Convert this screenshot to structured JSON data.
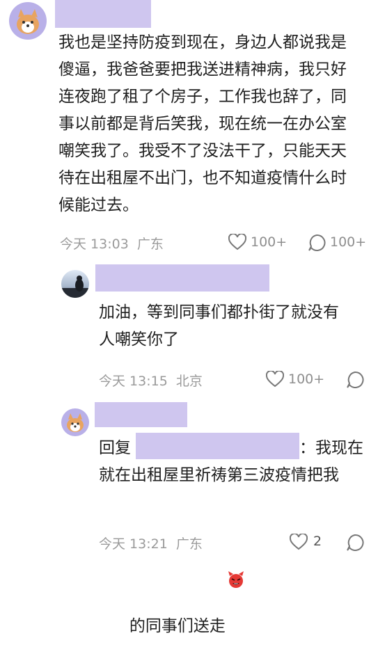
{
  "comments": [
    {
      "text_lines": [
        "我也是坚持防疫到现在，身边人都说我是",
        "傻逼，我爸爸要把我送进精神病，我只好",
        "连夜跑了租了个房子，工作我也辞了，同",
        "事以前都是背后笑我，现在统一在办公室",
        "嘲笑我了。我受不了没法干了，只能天天",
        "待在出租屋不出门，也不知道疫情什么时",
        "候能过去。"
      ],
      "time": "今天 13:03",
      "location": "广东",
      "likes": "100+",
      "replies": "100+"
    },
    {
      "text_lines": [
        "加油，等到同事们都扑街了就没有",
        "人嘲笑你了"
      ],
      "time": "今天 13:15",
      "location": "北京",
      "likes": "100+"
    },
    {
      "reply_prefix": "回复",
      "reply_suffix": "：我现在",
      "text_lines": [
        "就在出租屋里祈祷第三波疫情把我",
        "的同事们送走"
      ],
      "emoji": "devil-emoji",
      "time": "今天 13:21",
      "location": "广东",
      "likes": "2"
    }
  ],
  "colors": {
    "redaction": "#cfc6ef",
    "meta_text": "#9a9a9a",
    "avatar_bg": "#b9b0e8",
    "emoji_red": "#e53935"
  },
  "icons": [
    "heart-icon",
    "comment-icon",
    "devil-emoji"
  ]
}
